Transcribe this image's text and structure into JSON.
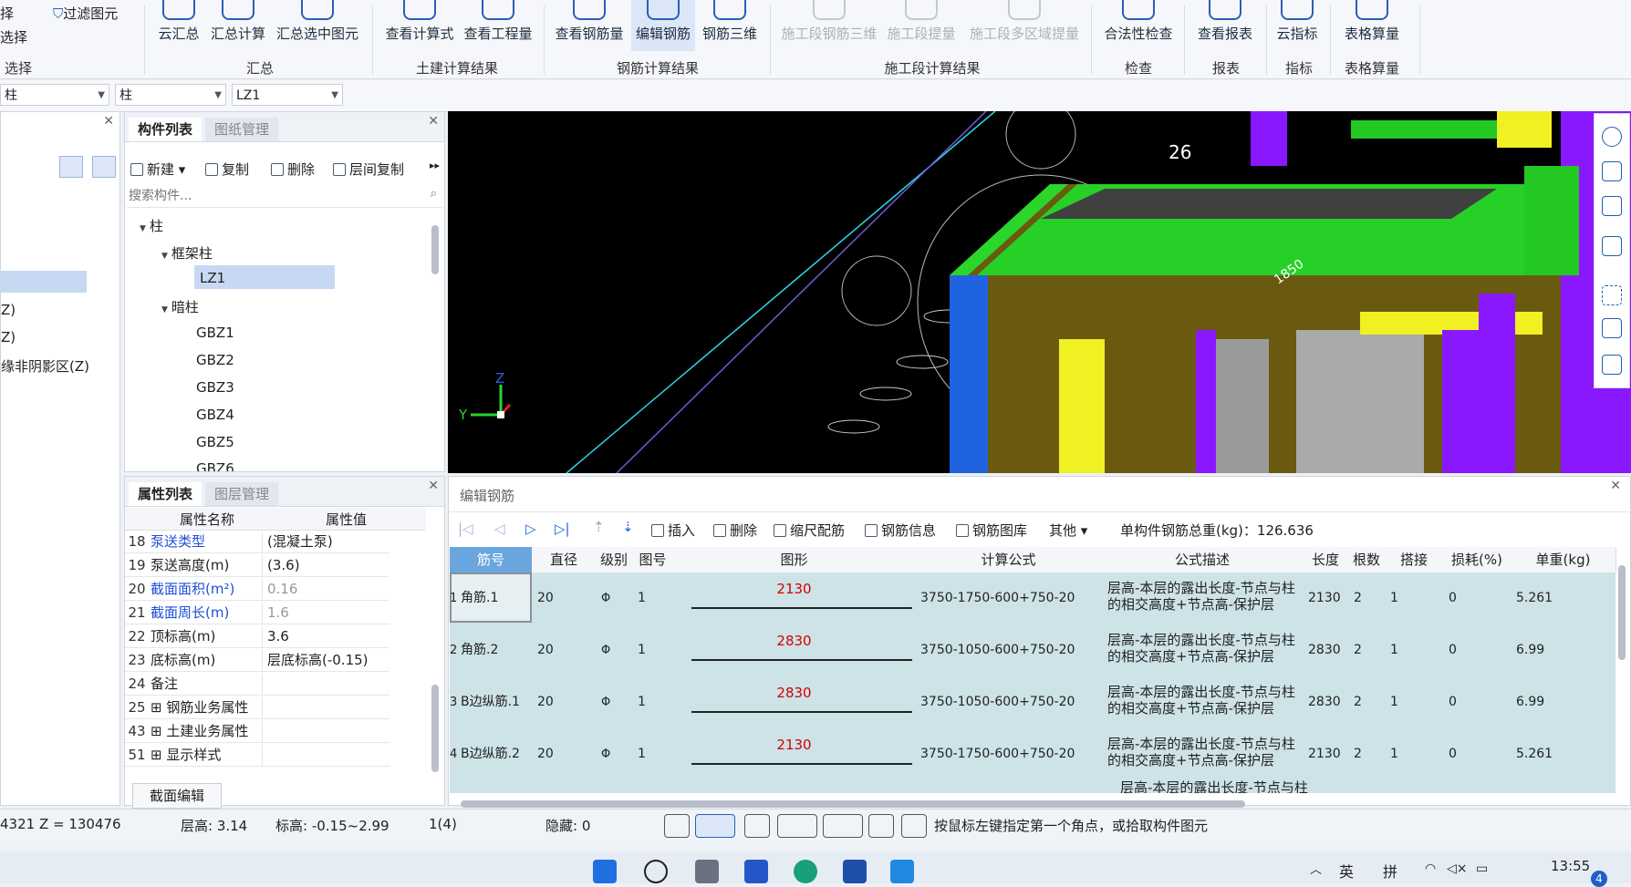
{
  "ribbon": {
    "left_items": {
      "filter_label": "过滤图元",
      "select_a": "择",
      "select_b": "选择",
      "group": "选择"
    },
    "groups": [
      {
        "label": "汇总",
        "buttons": [
          "云汇总",
          "汇总计算",
          "汇总选中图元"
        ]
      },
      {
        "label": "土建计算结果",
        "buttons": [
          "查看计算式",
          "查看工程量"
        ]
      },
      {
        "label": "钢筋计算结果",
        "buttons": [
          "查看钢筋量",
          "编辑钢筋",
          "钢筋三维"
        ]
      },
      {
        "label": "施工段计算结果",
        "buttons": [
          "施工段钢筋三维",
          "施工段提量",
          "施工段多区域提量"
        ]
      },
      {
        "label": "检查",
        "buttons": [
          "合法性检查"
        ]
      },
      {
        "label": "报表",
        "buttons": [
          "查看报表"
        ]
      },
      {
        "label": "指标",
        "buttons": [
          "云指标"
        ]
      },
      {
        "label": "表格算量",
        "buttons": [
          "表格算量"
        ]
      }
    ]
  },
  "selectors": {
    "s1": "柱",
    "s2": "柱",
    "s3": "LZ1"
  },
  "left_panel": {
    "items": [
      "Z)",
      "Z)",
      "缘非阴影区(Z)"
    ]
  },
  "component_panel": {
    "tabs": [
      "构件列表",
      "图纸管理"
    ],
    "tools": {
      "new": "新建",
      "copy": "复制",
      "delete": "删除",
      "floor_copy": "层间复制"
    },
    "search_placeholder": "搜索构件...",
    "tree": {
      "root": "柱",
      "frame": "框架柱",
      "frame_child": "LZ1",
      "hidden": "暗柱",
      "hidden_children": [
        "GBZ1",
        "GBZ2",
        "GBZ3",
        "GBZ4",
        "GBZ5",
        "GBZ6"
      ]
    }
  },
  "property_panel": {
    "tabs": [
      "属性列表",
      "图层管理"
    ],
    "headers": [
      "属性名称",
      "属性值"
    ],
    "rows": [
      {
        "n": "18",
        "k": "泵送类型",
        "v": "(混凝土泵)",
        "blue": true,
        "grey": false
      },
      {
        "n": "19",
        "k": "泵送高度(m)",
        "v": "(3.6)",
        "blue": false,
        "grey": false
      },
      {
        "n": "20",
        "k": "截面面积(m²)",
        "v": "0.16",
        "blue": true,
        "grey": true
      },
      {
        "n": "21",
        "k": "截面周长(m)",
        "v": "1.6",
        "blue": true,
        "grey": true
      },
      {
        "n": "22",
        "k": "顶标高(m)",
        "v": "3.6",
        "blue": false,
        "grey": false
      },
      {
        "n": "23",
        "k": "底标高(m)",
        "v": "层底标高(-0.15)",
        "blue": false,
        "grey": false
      },
      {
        "n": "24",
        "k": "备注",
        "v": "",
        "blue": false,
        "grey": false
      },
      {
        "n": "25",
        "k": "⊞ 钢筋业务属性",
        "v": "",
        "blue": false,
        "grey": false
      },
      {
        "n": "43",
        "k": "⊞ 土建业务属性",
        "v": "",
        "blue": false,
        "grey": false
      },
      {
        "n": "51",
        "k": "⊞ 显示样式",
        "v": "",
        "blue": false,
        "grey": false
      }
    ],
    "section_edit_button": "截面编辑"
  },
  "view3d": {
    "labels": [
      "26",
      "1850"
    ],
    "axis_y": "Y",
    "axis_z": "Z"
  },
  "rebar_editor": {
    "title": "编辑钢筋",
    "tools": {
      "insert": "插入",
      "delete": "删除",
      "scale": "缩尺配筋",
      "info": "钢筋信息",
      "lib": "钢筋图库",
      "other": "其他"
    },
    "total_label": "单构件钢筋总重(kg)：126.636",
    "headers": [
      "筋号",
      "直径(mm)",
      "级别",
      "图号",
      "图形",
      "计算公式",
      "公式描述",
      "长度",
      "根数",
      "搭接",
      "损耗(%)",
      "单重(kg)"
    ],
    "rows": [
      {
        "idx": "1",
        "name": "角筋.1",
        "dia": "20",
        "grade": "Φ",
        "fig": "1",
        "shape": "2130",
        "formula": "3750-1750-600+750-20",
        "desc": "层高-本层的露出长度-节点与柱的相交高度+节点高-保护层",
        "len": "2130",
        "count": "2",
        "lap": "1",
        "loss": "0",
        "weight": "5.261"
      },
      {
        "idx": "2",
        "name": "角筋.2",
        "dia": "20",
        "grade": "Φ",
        "fig": "1",
        "shape": "2830",
        "formula": "3750-1050-600+750-20",
        "desc": "层高-本层的露出长度-节点与柱的相交高度+节点高-保护层",
        "len": "2830",
        "count": "2",
        "lap": "1",
        "loss": "0",
        "weight": "6.99"
      },
      {
        "idx": "3",
        "name": "B边纵筋.1",
        "dia": "20",
        "grade": "Φ",
        "fig": "1",
        "shape": "2830",
        "formula": "3750-1050-600+750-20",
        "desc": "层高-本层的露出长度-节点与柱的相交高度+节点高-保护层",
        "len": "2830",
        "count": "2",
        "lap": "1",
        "loss": "0",
        "weight": "6.99"
      },
      {
        "idx": "4",
        "name": "B边纵筋.2",
        "dia": "20",
        "grade": "Φ",
        "fig": "1",
        "shape": "2130",
        "formula": "3750-1750-600+750-20",
        "desc": "层高-本层的露出长度-节点与柱的相交高度+节点高-保护层",
        "len": "2130",
        "count": "2",
        "lap": "1",
        "loss": "0",
        "weight": "5.261"
      }
    ],
    "partial_row_desc": "层高-本层的露出长度-节点与柱"
  },
  "status": {
    "coord": "4321 Z = 130476",
    "floor_height": "层高:  3.14",
    "elevation": "标高:  -0.15~2.99",
    "count": "1(4)",
    "hidden": "隐藏:  0",
    "hint": "按鼠标左键指定第一个角点，或拾取构件图元"
  },
  "taskbar": {
    "ime1": "英",
    "ime2": "拼",
    "time": "13:55",
    "badge": "4"
  }
}
